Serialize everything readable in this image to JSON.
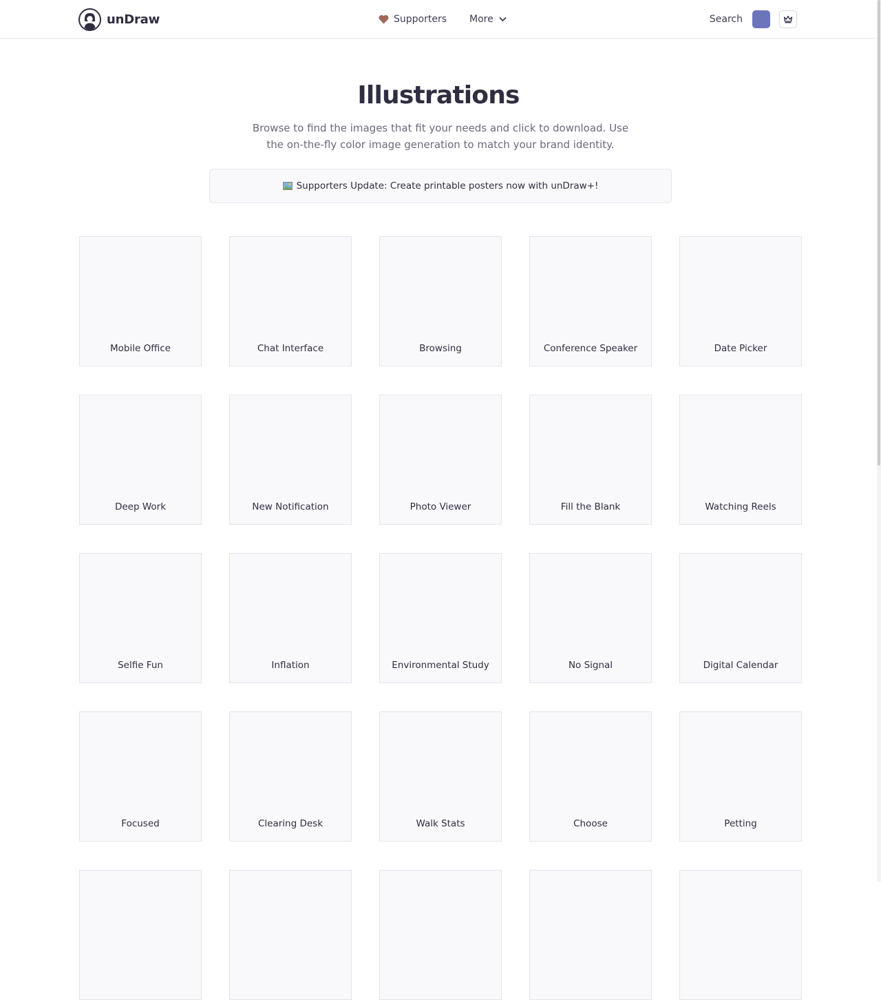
{
  "header": {
    "brand": "unDraw",
    "nav": {
      "supporters": "Supporters",
      "more": "More"
    },
    "search_label": "Search",
    "accent_color": "#6c74bc",
    "heart_color": "#a0685a"
  },
  "hero": {
    "title": "Illustrations",
    "subtitle": "Browse to find the images that fit your needs and click to download. Use the on-the-fly color image generation to match your brand identity."
  },
  "banner": {
    "text": "Supporters Update: Create printable posters now with unDraw+!"
  },
  "illustrations": [
    "Mobile Office",
    "Chat Interface",
    "Browsing",
    "Conference Speaker",
    "Date Picker",
    "Deep Work",
    "New Notification",
    "Photo Viewer",
    "Fill the Blank",
    "Watching Reels",
    "Selfie Fun",
    "Inflation",
    "Environmental Study",
    "No Signal",
    "Digital Calendar",
    "Focused",
    "Clearing Desk",
    "Walk Stats",
    "Choose",
    "Petting",
    "",
    "",
    "",
    "",
    ""
  ]
}
